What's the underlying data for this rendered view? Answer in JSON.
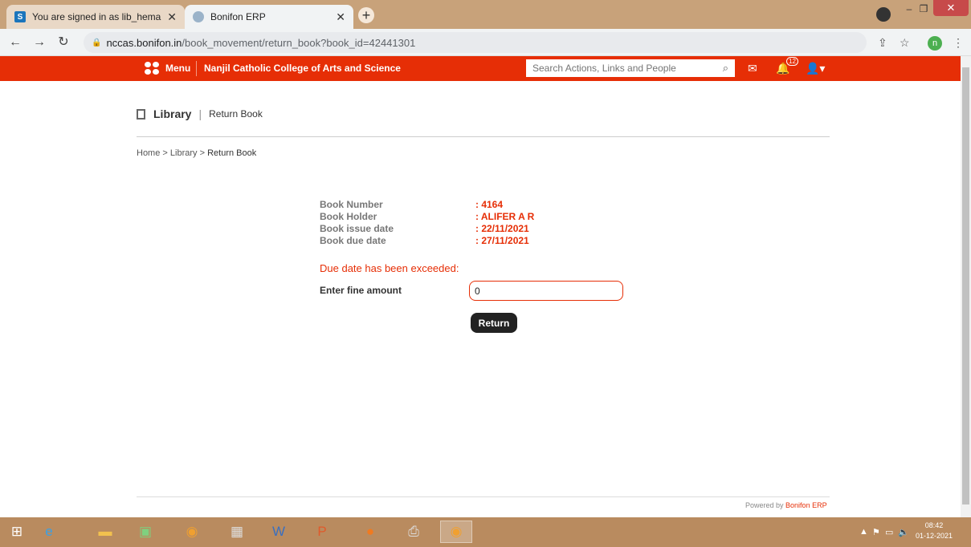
{
  "browser": {
    "tabs": [
      {
        "label": "You are signed in as lib_hema",
        "favicon": "S"
      },
      {
        "label": "Bonifon ERP",
        "favicon": "bonifon-icon"
      }
    ],
    "url_host": "nccas.bonifon.in",
    "url_path": "/book_movement/return_book?book_id=42441301",
    "profile_initial": "n"
  },
  "header": {
    "menu_label": "Menu",
    "college_name": "Nanjil Catholic College of Arts and Science",
    "search_placeholder": "Search Actions, Links and People",
    "notification_count": "12"
  },
  "page": {
    "title": "Library",
    "separator": "|",
    "subtitle": "Return Book",
    "breadcrumb": {
      "home": "Home",
      "sep1": ">",
      "library": "Library",
      "sep2": ">",
      "current": "Return Book"
    }
  },
  "book": {
    "fields": [
      {
        "label": "Book Number",
        "value": ": 4164"
      },
      {
        "label": "Book Holder",
        "value": ": ALIFER A R"
      },
      {
        "label": "Book issue date",
        "value": ": 22/11/2021"
      },
      {
        "label": "Book due date",
        "value": ": 27/11/2021"
      }
    ]
  },
  "fine": {
    "warning": "Due date has been exceeded:",
    "label": "Enter fine amount",
    "value": "0",
    "submit_label": "Return"
  },
  "footer": {
    "powered_by": "Powered by",
    "brand": "Bonifon ERP"
  },
  "taskbar": {
    "time": "08:42",
    "date": "01-12-2021"
  },
  "colors": {
    "accent": "#e62e06",
    "button_dark": "#222222"
  }
}
